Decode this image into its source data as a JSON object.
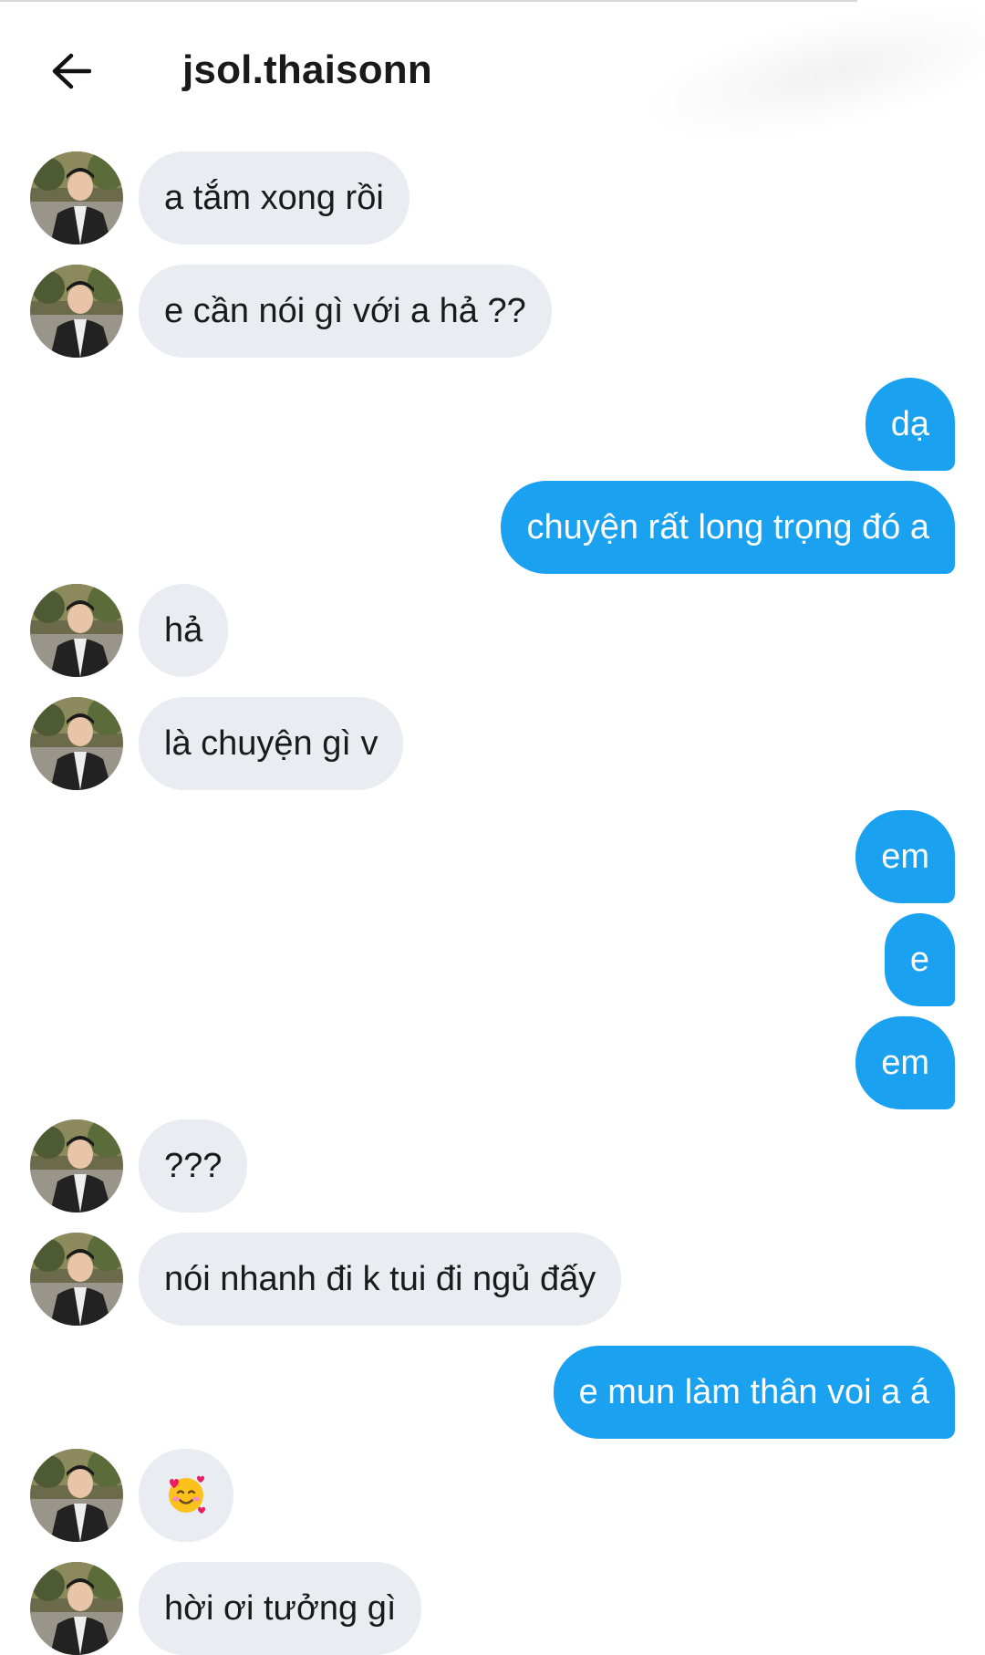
{
  "header": {
    "title": "jsol.thaisonn",
    "back_icon": "arrow-left-icon"
  },
  "colors": {
    "incoming_bubble": "#e9ecf0",
    "outgoing_bubble": "#1aa1ef",
    "outgoing_text": "#ffffff",
    "incoming_text": "#1a1a1a"
  },
  "messages": [
    {
      "from": "them",
      "text": "a tắm xong rồi"
    },
    {
      "from": "them",
      "text": "e cần nói gì với a hả ??"
    },
    {
      "from": "me",
      "text": "dạ"
    },
    {
      "from": "me",
      "text": "chuyện rất long trọng đó a"
    },
    {
      "from": "them",
      "text": "hả"
    },
    {
      "from": "them",
      "text": "là chuyện gì v"
    },
    {
      "from": "me",
      "text": "em"
    },
    {
      "from": "me",
      "text": "e"
    },
    {
      "from": "me",
      "text": "em"
    },
    {
      "from": "them",
      "text": "???"
    },
    {
      "from": "them",
      "text": "nói nhanh đi k tui đi ngủ đấy"
    },
    {
      "from": "me",
      "text": "e mun làm thân voi a á"
    },
    {
      "from": "them",
      "text": "",
      "emoji": "smiling-face-with-hearts-icon"
    },
    {
      "from": "them",
      "text": "hời ơi tưởng gì"
    }
  ]
}
